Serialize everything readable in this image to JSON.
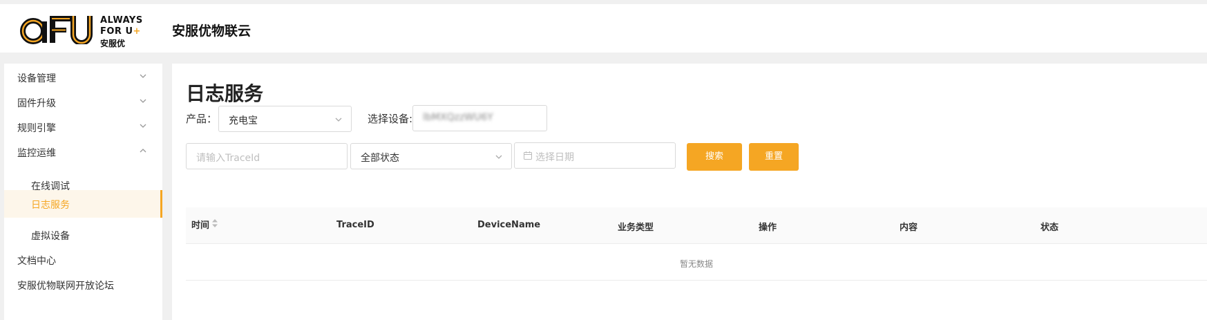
{
  "header": {
    "logo": {
      "mark": "aFU",
      "line1": "ALWAYS",
      "line2": "FOR U",
      "line2_plus": "+",
      "line3": "安服优"
    },
    "site_title": "安服优物联云"
  },
  "sidebar": {
    "items": [
      {
        "label": "设备管理",
        "icon": "chevron-down-icon"
      },
      {
        "label": "固件升级",
        "icon": "chevron-down-icon"
      },
      {
        "label": "规则引擎",
        "icon": "chevron-down-icon"
      },
      {
        "label": "监控运维",
        "icon": "chevron-up-icon",
        "expanded": true
      },
      {
        "label": "在线调试"
      },
      {
        "label": "日志服务",
        "active": true
      },
      {
        "label": "虚拟设备"
      },
      {
        "label": "文档中心"
      },
      {
        "label": "安服优物联网开放论坛"
      }
    ]
  },
  "main": {
    "title": "日志服务",
    "filters": {
      "product_label": "产品：",
      "product_value": "充电宝",
      "device_label": "选择设备:",
      "device_value": "lbMXQzzWU6Y",
      "traceid_placeholder": "请输入TraceId",
      "status_value": "全部状态",
      "date_placeholder": "选择日期",
      "search_button": "搜索",
      "reset_button": "重置"
    },
    "table": {
      "columns": [
        "时间",
        "TraceID",
        "DeviceName",
        "业务类型",
        "操作",
        "内容",
        "状态"
      ],
      "empty_text": "暂无数据"
    }
  },
  "colors": {
    "accent": "#f5a623",
    "background": "#f0f0f0"
  }
}
